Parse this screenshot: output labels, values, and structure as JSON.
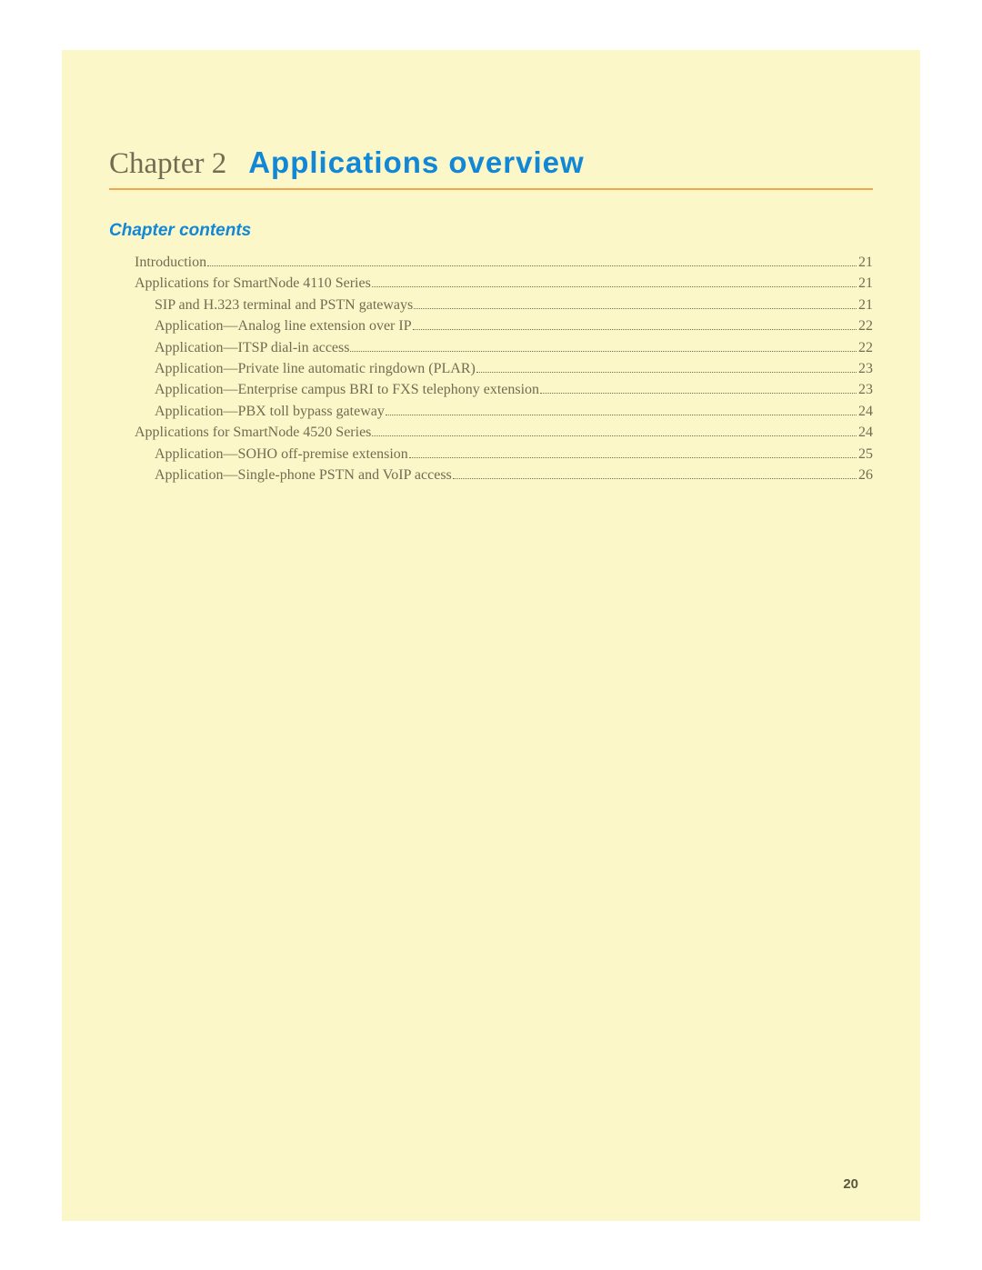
{
  "chapter": {
    "label": "Chapter 2",
    "title": "Applications overview"
  },
  "contents_heading": "Chapter contents",
  "toc": [
    {
      "label": "Introduction",
      "page": "21",
      "indent": 0
    },
    {
      "label": "Applications for SmartNode 4110 Series ",
      "page": "21",
      "indent": 0
    },
    {
      "label": "SIP and H.323 terminal and PSTN gateways ",
      "page": "21",
      "indent": 1
    },
    {
      "label": "Application—Analog line extension over IP ",
      "page": "22",
      "indent": 1
    },
    {
      "label": "Application—ITSP dial-in access ",
      "page": "22",
      "indent": 1
    },
    {
      "label": "Application—Private line automatic ringdown (PLAR) ",
      "page": "23",
      "indent": 1
    },
    {
      "label": "Application—Enterprise campus BRI to FXS telephony extension ",
      "page": "23",
      "indent": 1
    },
    {
      "label": "Application—PBX toll bypass gateway ",
      "page": "24",
      "indent": 1
    },
    {
      "label": "Applications for SmartNode 4520 Series ",
      "page": "24",
      "indent": 0
    },
    {
      "label": "Application—SOHO off-premise extension ",
      "page": "25",
      "indent": 1
    },
    {
      "label": "Application—Single-phone PSTN and VoIP access ",
      "page": "26",
      "indent": 1
    }
  ],
  "page_number": "20"
}
